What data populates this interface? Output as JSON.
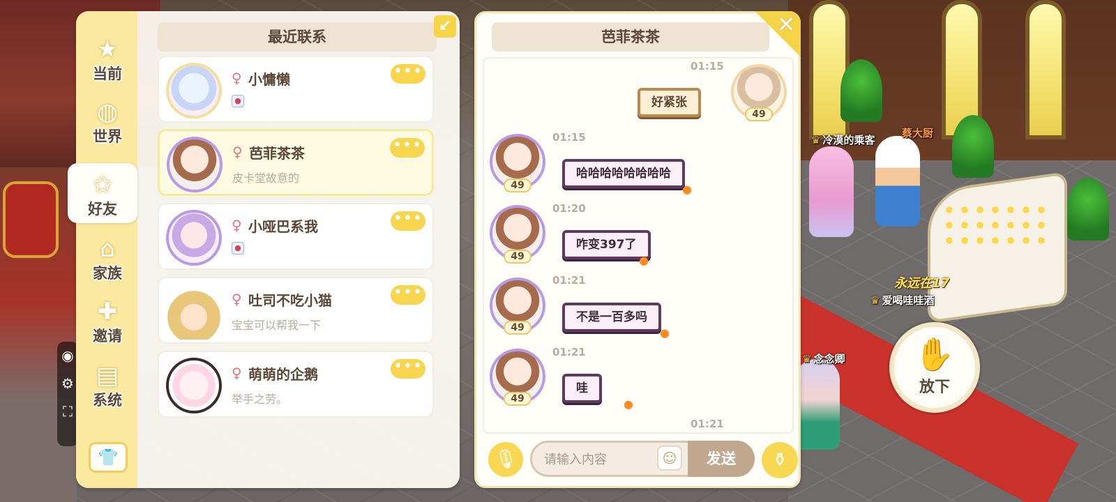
{
  "scene": {
    "name_tags": [
      "冷漠的乘客",
      "蔡大厨",
      "爱喝哇哇酒",
      "念念卿"
    ],
    "badge": "永远在17",
    "drop_button_label": "放下"
  },
  "tabs": [
    {
      "label": "当前",
      "icon": "star-icon"
    },
    {
      "label": "世界",
      "icon": "planet-icon"
    },
    {
      "label": "好友",
      "icon": "chat-star-icon",
      "active": true
    },
    {
      "label": "家族",
      "icon": "house-icon"
    },
    {
      "label": "邀请",
      "icon": "plus-envelope-icon"
    },
    {
      "label": "系统",
      "icon": "notice-icon"
    }
  ],
  "recent": {
    "title": "最近联系",
    "contacts": [
      {
        "name": "小慵懒",
        "gender": "♀",
        "preview": "",
        "has_pet_icon": true
      },
      {
        "name": "芭菲茶茶",
        "gender": "♀",
        "preview": "皮卡堂故意的",
        "selected": true
      },
      {
        "name": "小哑巴系我",
        "gender": "♀",
        "preview": "",
        "has_pet_icon": true
      },
      {
        "name": "吐司不吃小猫",
        "gender": "♀",
        "preview": "宝宝可以帮我一下"
      },
      {
        "name": "萌萌的企鹅",
        "gender": "♀",
        "preview": "举手之劳。"
      }
    ]
  },
  "chat": {
    "title": "芭菲茶茶",
    "messages": [
      {
        "time": "01:15",
        "text": "好紧张",
        "mine": true,
        "level": "49"
      },
      {
        "time": "01:15",
        "text": "哈哈哈哈哈哈哈哈",
        "mine": false,
        "level": "49"
      },
      {
        "time": "01:20",
        "text": "咋变397了",
        "mine": false,
        "level": "49"
      },
      {
        "time": "01:21",
        "text": "不是一百多吗",
        "mine": false,
        "level": "49"
      },
      {
        "time": "01:21",
        "text": "哇",
        "mine": false,
        "level": "49"
      },
      {
        "time": "01:21",
        "text": "",
        "mine": true,
        "level": ""
      }
    ],
    "input_placeholder": "请输入内容",
    "send_label": "发送"
  }
}
